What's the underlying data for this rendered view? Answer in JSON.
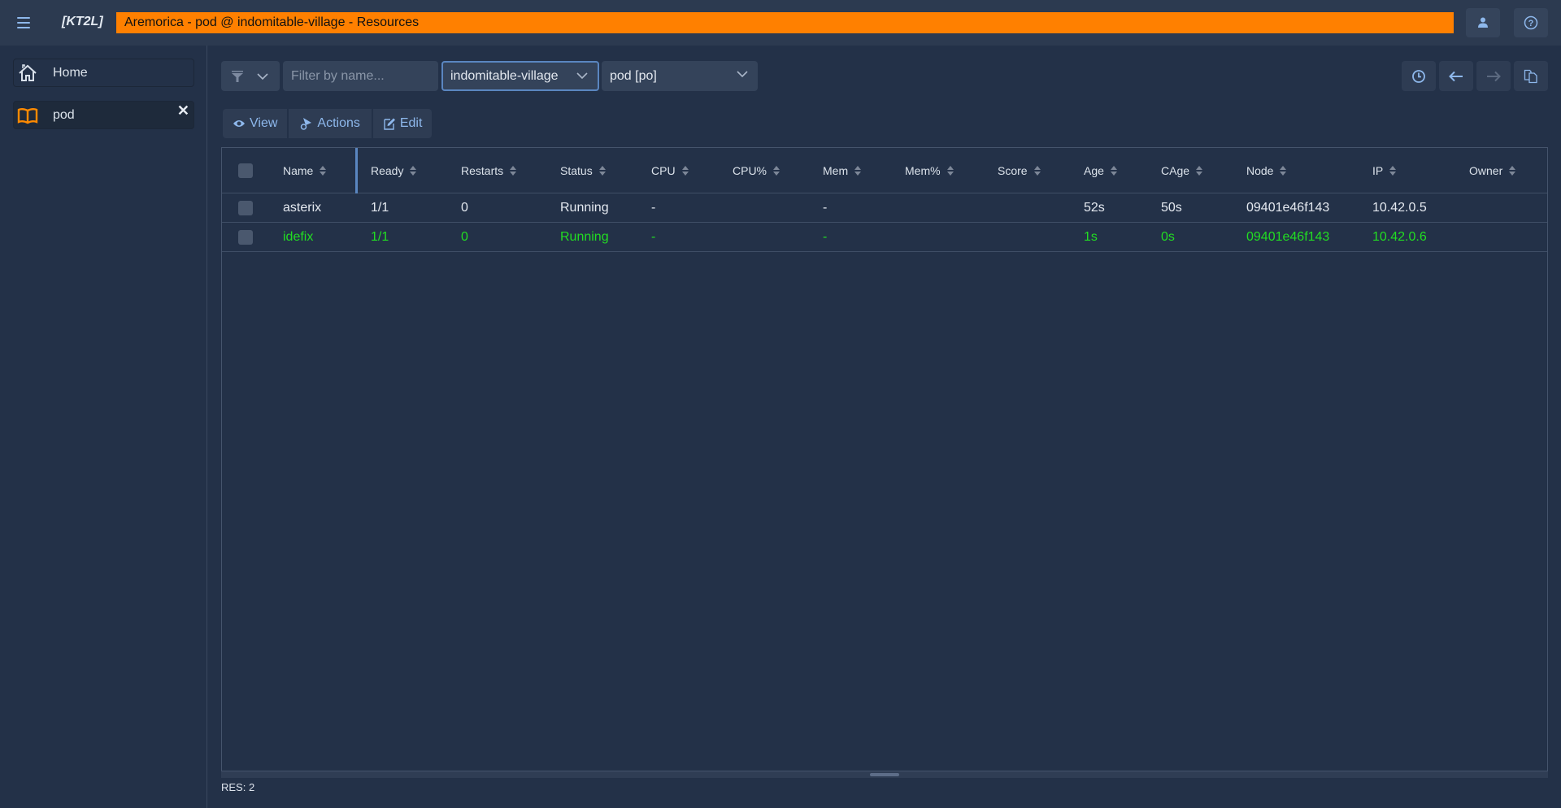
{
  "app": {
    "brand": "[KT2L]",
    "title": "Aremorica - pod @ indomitable-village - Resources",
    "title_color": "#ff8000"
  },
  "top_icons": {
    "user": "user-icon",
    "help": "help-icon"
  },
  "sidebar": {
    "items": [
      {
        "label": "Home",
        "icon": "home-icon"
      },
      {
        "label": "pod",
        "icon": "book-icon",
        "closable": true,
        "close_glyph": "✕"
      }
    ]
  },
  "toolbar": {
    "filter_placeholder": "Filter by name...",
    "filter_value": "",
    "namespace": "indomitable-village",
    "resource": "pod [po]"
  },
  "actions": {
    "view": "View",
    "actions": "Actions",
    "edit": "Edit"
  },
  "table": {
    "columns": [
      "Name",
      "Ready",
      "Restarts",
      "Status",
      "CPU",
      "CPU%",
      "Mem",
      "Mem%",
      "Score",
      "Age",
      "CAge",
      "Node",
      "IP",
      "Owner"
    ],
    "rows": [
      {
        "name": "asterix",
        "ready": "1/1",
        "restarts": "0",
        "status": "Running",
        "cpu": "-",
        "cpu_pct": "",
        "mem": "-",
        "mem_pct": "",
        "score": "",
        "age": "52s",
        "cage": "50s",
        "node": "09401e46f143",
        "ip": "10.42.0.5",
        "owner": "",
        "color": "#e4e9f0"
      },
      {
        "name": "idefix",
        "ready": "1/1",
        "restarts": "0",
        "status": "Running",
        "cpu": "-",
        "cpu_pct": "",
        "mem": "-",
        "mem_pct": "",
        "score": "",
        "age": "1s",
        "cage": "0s",
        "node": "09401e46f143",
        "ip": "10.42.0.6",
        "owner": "",
        "color": "#22dd22"
      }
    ]
  },
  "status": {
    "text": "RES: 2"
  }
}
